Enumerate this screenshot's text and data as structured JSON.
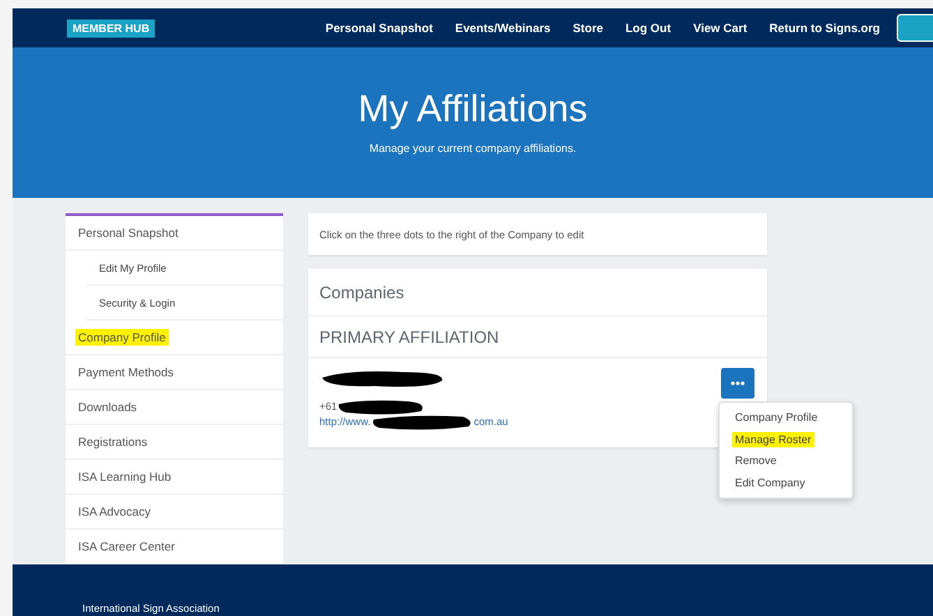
{
  "header": {
    "badge": "MEMBER HUB",
    "nav": [
      "Personal Snapshot",
      "Events/Webinars",
      "Store",
      "Log Out",
      "View Cart",
      "Return to Signs.org"
    ]
  },
  "hero": {
    "title": "My Affiliations",
    "subtitle": "Manage your current company affiliations."
  },
  "sidebar": {
    "items": [
      {
        "label": "Personal Snapshot",
        "highlighted": false,
        "children": [
          {
            "label": "Edit My Profile",
            "highlighted": false
          },
          {
            "label": "Security & Login",
            "highlighted": false
          }
        ]
      },
      {
        "label": "Company Profile",
        "highlighted": true
      },
      {
        "label": "Payment Methods",
        "highlighted": false
      },
      {
        "label": "Downloads",
        "highlighted": false
      },
      {
        "label": "Registrations",
        "highlighted": false
      },
      {
        "label": "ISA Learning Hub",
        "highlighted": false
      },
      {
        "label": "ISA Advocacy",
        "highlighted": false
      },
      {
        "label": "ISA Career Center",
        "highlighted": false
      }
    ]
  },
  "instructions": "Click on the three dots to the right of the Company to edit",
  "companies": {
    "title": "Companies",
    "section": "PRIMARY AFFILIATION",
    "phone": "+61",
    "url_start": "http://www.",
    "url_end": "com.au",
    "menu": [
      {
        "label": "Company Profile",
        "highlighted": false
      },
      {
        "label": "Manage Roster",
        "highlighted": true
      },
      {
        "label": "Remove",
        "highlighted": false
      },
      {
        "label": "Edit Company",
        "highlighted": false
      }
    ]
  },
  "footer": {
    "text": "International Sign Association"
  }
}
